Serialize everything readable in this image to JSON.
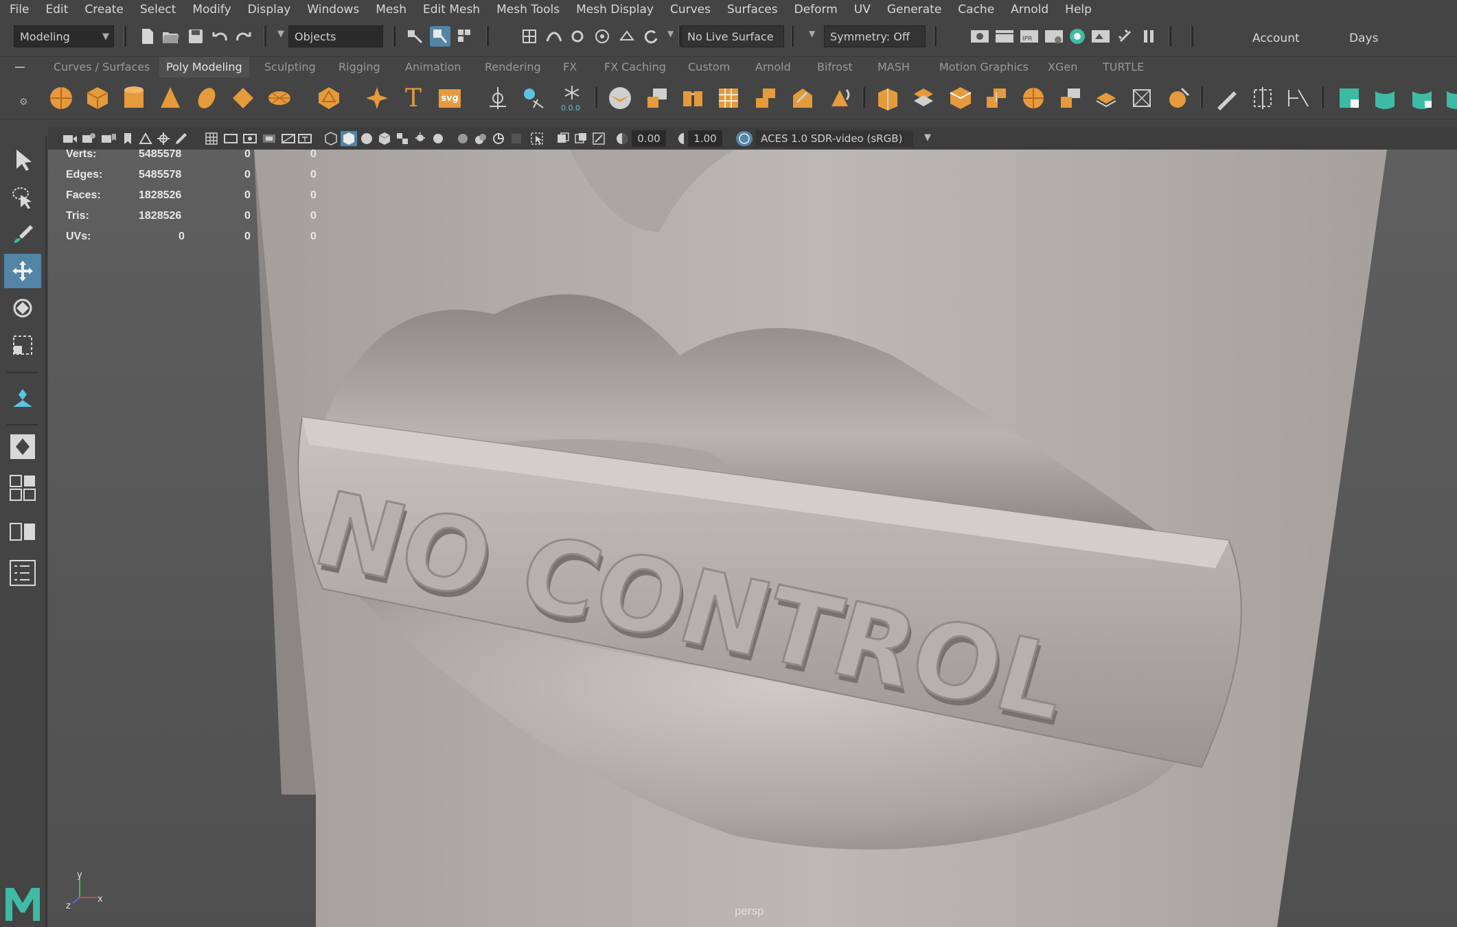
{
  "menu": [
    "File",
    "Edit",
    "Create",
    "Select",
    "Modify",
    "Display",
    "Windows",
    "Mesh",
    "Edit Mesh",
    "Mesh Tools",
    "Mesh Display",
    "Curves",
    "Surfaces",
    "Deform",
    "UV",
    "Generate",
    "Cache",
    "Arnold",
    "Help"
  ],
  "status": {
    "workspace": "Modeling",
    "objects": "Objects",
    "live_surface": "No Live Surface",
    "symmetry": "Symmetry: Off",
    "account": "Account",
    "days": "Days"
  },
  "shelf_tabs": [
    "Curves / Surfaces",
    "Poly Modeling",
    "Sculpting",
    "Rigging",
    "Animation",
    "Rendering",
    "FX",
    "FX Caching",
    "Custom",
    "Arnold",
    "Bifrost",
    "MASH",
    "Motion Graphics",
    "XGen",
    "TURTLE"
  ],
  "shelf_active": "Poly Modeling",
  "shelf_icons": {
    "svg_label": "svg",
    "type_label": "T",
    "sym_value": "0.0.0"
  },
  "panel": {
    "exposure": "0.00",
    "gamma": "1.00",
    "color_space": "ACES 1.0 SDR-video (sRGB)"
  },
  "hud": {
    "rows": [
      {
        "label": "Verts:",
        "a": "5485578",
        "b": "0",
        "c": "0"
      },
      {
        "label": "Edges:",
        "a": "5485578",
        "b": "0",
        "c": "0"
      },
      {
        "label": "Faces:",
        "a": "1828526",
        "b": "0",
        "c": "0"
      },
      {
        "label": "Tris:",
        "a": "1828526",
        "b": "0",
        "c": "0"
      },
      {
        "label": "UVs:",
        "a": "0",
        "b": "0",
        "c": "0"
      }
    ]
  },
  "viewport": {
    "camera": "persp",
    "model_text": "NO CONTROL",
    "axis_x": "x",
    "axis_y": "y",
    "axis_z": "z"
  },
  "colors": {
    "accent": "#5285a6",
    "shelf_orange": "#e59a3c",
    "teal": "#3dbba5"
  }
}
